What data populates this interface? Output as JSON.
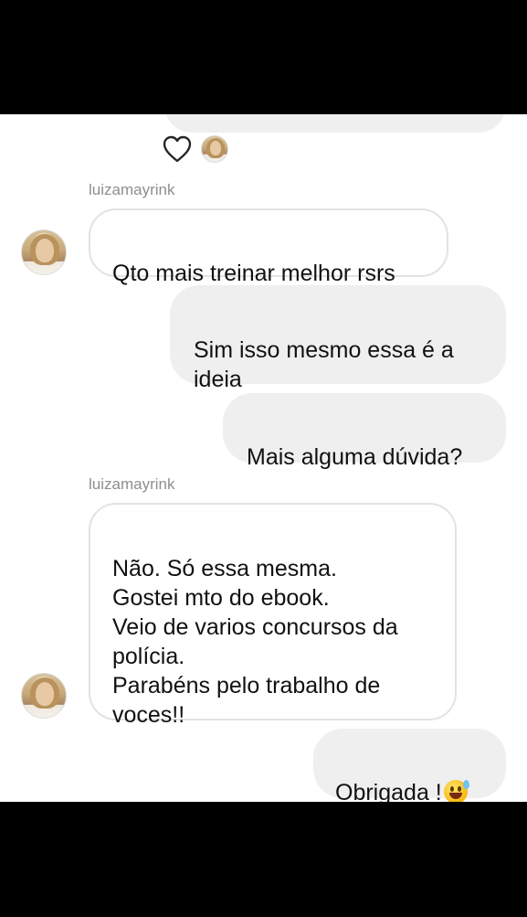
{
  "conversation": {
    "contact_username": "luizamayrink",
    "icons": {
      "heart": "heart-outline-icon",
      "emoji": "grinning-sweat-emoji"
    },
    "messages": [
      {
        "id": "m1",
        "direction": "received",
        "text": "Qto mais treinar melhor rsrs"
      },
      {
        "id": "m2",
        "direction": "sent",
        "text": "Sim isso mesmo essa é a\nideia"
      },
      {
        "id": "m3",
        "direction": "sent",
        "text": "Mais alguma dúvida?"
      },
      {
        "id": "m4",
        "direction": "received",
        "text": "Não. Só essa mesma.\nGostei mto do ebook.\nVeio de varios concursos da\npolícia.\nParabéns pelo trabalho de\nvoces!!"
      },
      {
        "id": "m5",
        "direction": "sent",
        "text": "Obrigada !"
      }
    ]
  },
  "colors": {
    "sent_bubble": "#efefef",
    "received_border": "#e3e3e3",
    "username_text": "#8e8e8e",
    "background": "#ffffff"
  }
}
